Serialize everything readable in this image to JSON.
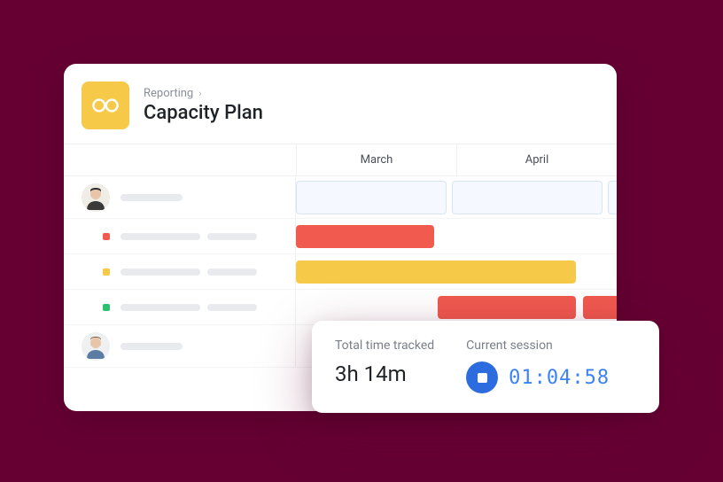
{
  "colors": {
    "brand_yellow": "#F7C948",
    "bar_red": "#F05A4F",
    "bar_yellow": "#F7C948",
    "bar_green": "#2FBF71",
    "stop_blue": "#2D6CDF",
    "session_blue": "#3B82F6"
  },
  "header": {
    "breadcrumb": "Reporting",
    "title": "Capacity Plan"
  },
  "timeline": {
    "months": [
      "March",
      "April"
    ]
  },
  "rows": [
    {
      "type": "person",
      "avatar": "person-1"
    },
    {
      "type": "task",
      "dot_color": "bar_red"
    },
    {
      "type": "task",
      "dot_color": "bar_yellow"
    },
    {
      "type": "task",
      "dot_color": "bar_green"
    },
    {
      "type": "person",
      "avatar": "person-2"
    }
  ],
  "timer": {
    "total_label": "Total time tracked",
    "total_value": "3h 14m",
    "session_label": "Current session",
    "session_value": "01:04:58"
  }
}
